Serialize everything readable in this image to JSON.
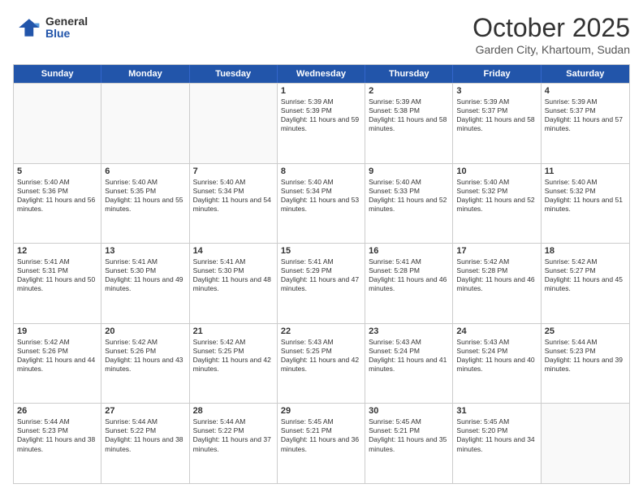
{
  "logo": {
    "general": "General",
    "blue": "Blue"
  },
  "header": {
    "month": "October 2025",
    "location": "Garden City, Khartoum, Sudan"
  },
  "weekdays": [
    "Sunday",
    "Monday",
    "Tuesday",
    "Wednesday",
    "Thursday",
    "Friday",
    "Saturday"
  ],
  "rows": [
    [
      {
        "day": "",
        "sunrise": "",
        "sunset": "",
        "daylight": ""
      },
      {
        "day": "",
        "sunrise": "",
        "sunset": "",
        "daylight": ""
      },
      {
        "day": "",
        "sunrise": "",
        "sunset": "",
        "daylight": ""
      },
      {
        "day": "1",
        "sunrise": "Sunrise: 5:39 AM",
        "sunset": "Sunset: 5:39 PM",
        "daylight": "Daylight: 11 hours and 59 minutes."
      },
      {
        "day": "2",
        "sunrise": "Sunrise: 5:39 AM",
        "sunset": "Sunset: 5:38 PM",
        "daylight": "Daylight: 11 hours and 58 minutes."
      },
      {
        "day": "3",
        "sunrise": "Sunrise: 5:39 AM",
        "sunset": "Sunset: 5:37 PM",
        "daylight": "Daylight: 11 hours and 58 minutes."
      },
      {
        "day": "4",
        "sunrise": "Sunrise: 5:39 AM",
        "sunset": "Sunset: 5:37 PM",
        "daylight": "Daylight: 11 hours and 57 minutes."
      }
    ],
    [
      {
        "day": "5",
        "sunrise": "Sunrise: 5:40 AM",
        "sunset": "Sunset: 5:36 PM",
        "daylight": "Daylight: 11 hours and 56 minutes."
      },
      {
        "day": "6",
        "sunrise": "Sunrise: 5:40 AM",
        "sunset": "Sunset: 5:35 PM",
        "daylight": "Daylight: 11 hours and 55 minutes."
      },
      {
        "day": "7",
        "sunrise": "Sunrise: 5:40 AM",
        "sunset": "Sunset: 5:34 PM",
        "daylight": "Daylight: 11 hours and 54 minutes."
      },
      {
        "day": "8",
        "sunrise": "Sunrise: 5:40 AM",
        "sunset": "Sunset: 5:34 PM",
        "daylight": "Daylight: 11 hours and 53 minutes."
      },
      {
        "day": "9",
        "sunrise": "Sunrise: 5:40 AM",
        "sunset": "Sunset: 5:33 PM",
        "daylight": "Daylight: 11 hours and 52 minutes."
      },
      {
        "day": "10",
        "sunrise": "Sunrise: 5:40 AM",
        "sunset": "Sunset: 5:32 PM",
        "daylight": "Daylight: 11 hours and 52 minutes."
      },
      {
        "day": "11",
        "sunrise": "Sunrise: 5:40 AM",
        "sunset": "Sunset: 5:32 PM",
        "daylight": "Daylight: 11 hours and 51 minutes."
      }
    ],
    [
      {
        "day": "12",
        "sunrise": "Sunrise: 5:41 AM",
        "sunset": "Sunset: 5:31 PM",
        "daylight": "Daylight: 11 hours and 50 minutes."
      },
      {
        "day": "13",
        "sunrise": "Sunrise: 5:41 AM",
        "sunset": "Sunset: 5:30 PM",
        "daylight": "Daylight: 11 hours and 49 minutes."
      },
      {
        "day": "14",
        "sunrise": "Sunrise: 5:41 AM",
        "sunset": "Sunset: 5:30 PM",
        "daylight": "Daylight: 11 hours and 48 minutes."
      },
      {
        "day": "15",
        "sunrise": "Sunrise: 5:41 AM",
        "sunset": "Sunset: 5:29 PM",
        "daylight": "Daylight: 11 hours and 47 minutes."
      },
      {
        "day": "16",
        "sunrise": "Sunrise: 5:41 AM",
        "sunset": "Sunset: 5:28 PM",
        "daylight": "Daylight: 11 hours and 46 minutes."
      },
      {
        "day": "17",
        "sunrise": "Sunrise: 5:42 AM",
        "sunset": "Sunset: 5:28 PM",
        "daylight": "Daylight: 11 hours and 46 minutes."
      },
      {
        "day": "18",
        "sunrise": "Sunrise: 5:42 AM",
        "sunset": "Sunset: 5:27 PM",
        "daylight": "Daylight: 11 hours and 45 minutes."
      }
    ],
    [
      {
        "day": "19",
        "sunrise": "Sunrise: 5:42 AM",
        "sunset": "Sunset: 5:26 PM",
        "daylight": "Daylight: 11 hours and 44 minutes."
      },
      {
        "day": "20",
        "sunrise": "Sunrise: 5:42 AM",
        "sunset": "Sunset: 5:26 PM",
        "daylight": "Daylight: 11 hours and 43 minutes."
      },
      {
        "day": "21",
        "sunrise": "Sunrise: 5:42 AM",
        "sunset": "Sunset: 5:25 PM",
        "daylight": "Daylight: 11 hours and 42 minutes."
      },
      {
        "day": "22",
        "sunrise": "Sunrise: 5:43 AM",
        "sunset": "Sunset: 5:25 PM",
        "daylight": "Daylight: 11 hours and 42 minutes."
      },
      {
        "day": "23",
        "sunrise": "Sunrise: 5:43 AM",
        "sunset": "Sunset: 5:24 PM",
        "daylight": "Daylight: 11 hours and 41 minutes."
      },
      {
        "day": "24",
        "sunrise": "Sunrise: 5:43 AM",
        "sunset": "Sunset: 5:24 PM",
        "daylight": "Daylight: 11 hours and 40 minutes."
      },
      {
        "day": "25",
        "sunrise": "Sunrise: 5:44 AM",
        "sunset": "Sunset: 5:23 PM",
        "daylight": "Daylight: 11 hours and 39 minutes."
      }
    ],
    [
      {
        "day": "26",
        "sunrise": "Sunrise: 5:44 AM",
        "sunset": "Sunset: 5:23 PM",
        "daylight": "Daylight: 11 hours and 38 minutes."
      },
      {
        "day": "27",
        "sunrise": "Sunrise: 5:44 AM",
        "sunset": "Sunset: 5:22 PM",
        "daylight": "Daylight: 11 hours and 38 minutes."
      },
      {
        "day": "28",
        "sunrise": "Sunrise: 5:44 AM",
        "sunset": "Sunset: 5:22 PM",
        "daylight": "Daylight: 11 hours and 37 minutes."
      },
      {
        "day": "29",
        "sunrise": "Sunrise: 5:45 AM",
        "sunset": "Sunset: 5:21 PM",
        "daylight": "Daylight: 11 hours and 36 minutes."
      },
      {
        "day": "30",
        "sunrise": "Sunrise: 5:45 AM",
        "sunset": "Sunset: 5:21 PM",
        "daylight": "Daylight: 11 hours and 35 minutes."
      },
      {
        "day": "31",
        "sunrise": "Sunrise: 5:45 AM",
        "sunset": "Sunset: 5:20 PM",
        "daylight": "Daylight: 11 hours and 34 minutes."
      },
      {
        "day": "",
        "sunrise": "",
        "sunset": "",
        "daylight": ""
      }
    ]
  ]
}
